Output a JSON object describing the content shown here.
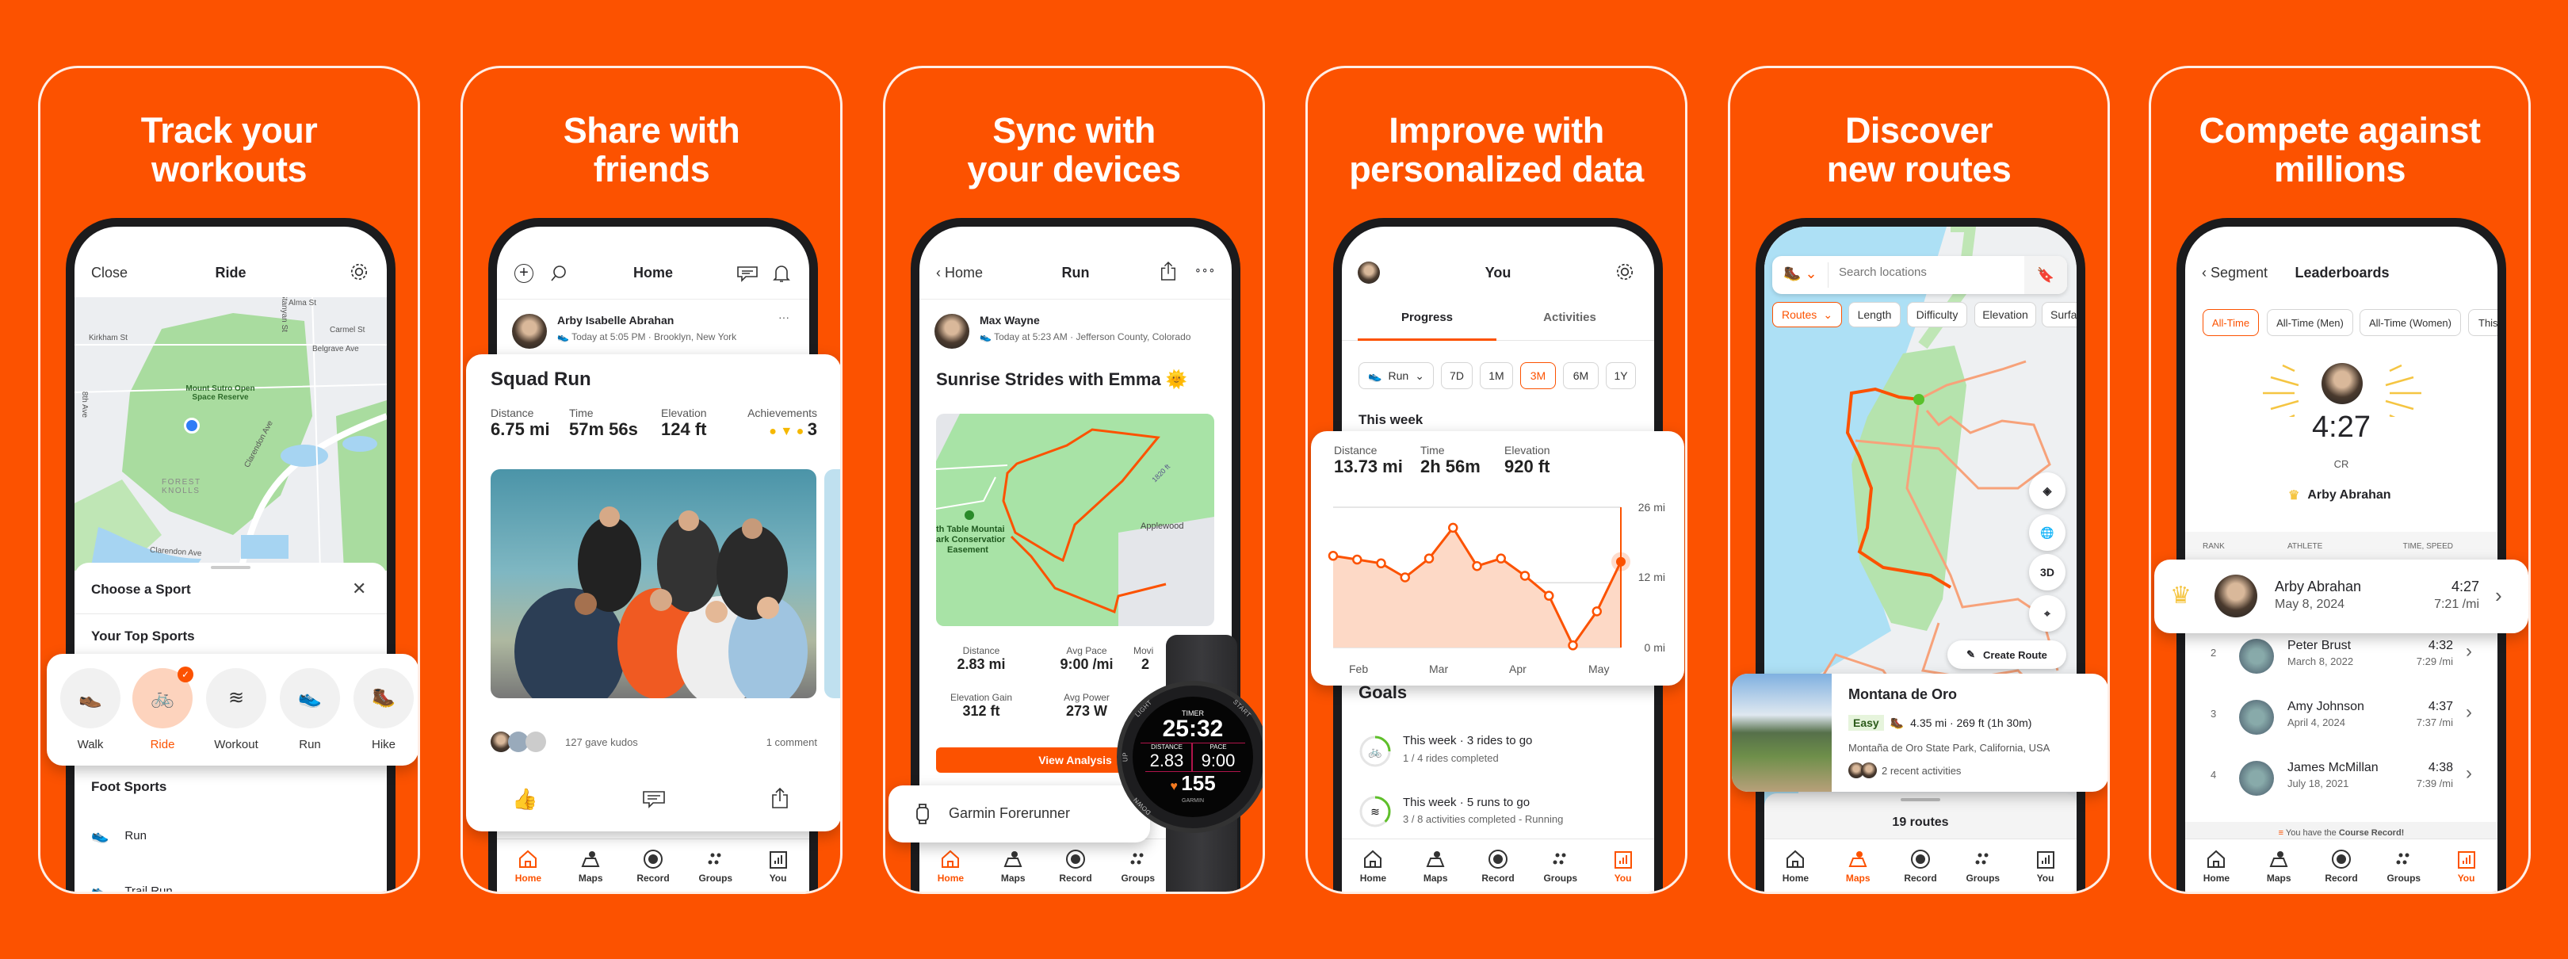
{
  "colors": {
    "brand": "#FC5200",
    "background": "#FC5200",
    "chart_fill": "#FDD9C6",
    "easy_badge": "#E6F4DC",
    "goal_ring": "#5FBF2A"
  },
  "nav": {
    "items": [
      {
        "label": "Home",
        "icon": "home-icon"
      },
      {
        "label": "Maps",
        "icon": "maps-icon"
      },
      {
        "label": "Record",
        "icon": "record-icon"
      },
      {
        "label": "Groups",
        "icon": "groups-icon"
      },
      {
        "label": "You",
        "icon": "you-icon"
      }
    ]
  },
  "panels": [
    {
      "title_line1": "Track your",
      "title_line2": "workouts",
      "header": {
        "left": "Close",
        "title": "Ride",
        "right_icon": "gear-icon"
      },
      "map": {
        "labels": [
          "Kirkham St",
          "Carmel St",
          "Belgrave Ave",
          "Mount Sutro Open",
          "Space Reserve",
          "FOREST",
          "KNOLLS",
          "Clarendon Ave",
          "Stanyan St",
          "Alma St",
          "8th Ave",
          "Clarendon Ave"
        ]
      },
      "sheet": {
        "title": "Choose a Sport",
        "top_heading": "Your Top Sports",
        "foot_heading": "Foot Sports",
        "top_sports": [
          {
            "label": "Walk",
            "icon": "walk-shoe-icon",
            "selected": false
          },
          {
            "label": "Ride",
            "icon": "bike-icon",
            "selected": true
          },
          {
            "label": "Workout",
            "icon": "workout-icon",
            "selected": false
          },
          {
            "label": "Run",
            "icon": "run-shoe-icon",
            "selected": false
          },
          {
            "label": "Hike",
            "icon": "hike-boot-icon",
            "selected": false
          }
        ],
        "foot_sports": [
          {
            "label": "Run",
            "icon": "run-shoe-icon"
          },
          {
            "label": "Trail Run",
            "icon": "trail-run-icon"
          }
        ]
      }
    },
    {
      "title_line1": "Share with",
      "title_line2": "friends",
      "header": {
        "title": "Home"
      },
      "post": {
        "athlete": "Arby Isabelle Abrahan",
        "meta": "Today at 5:05 PM · Brooklyn, New York",
        "title": "Squad Run",
        "stats": [
          {
            "label": "Distance",
            "value": "6.75 mi"
          },
          {
            "label": "Time",
            "value": "57m 56s"
          },
          {
            "label": "Elevation",
            "value": "124 ft"
          }
        ],
        "achievements": {
          "label": "Achievements",
          "count": "3"
        },
        "kudos": "127 gave kudos",
        "comments": "1 comment"
      },
      "active_nav": 0
    },
    {
      "title_line1": "Sync with",
      "title_line2": "your devices",
      "header": {
        "back": "Home",
        "title": "Run"
      },
      "post": {
        "athlete": "Max Wayne",
        "meta": "Today at 5:23 AM · Jefferson County, Colorado",
        "title": "Sunrise Strides with Emma 🌞",
        "map_labels": [
          "th Table Mountai",
          "ark Conservatior",
          "Easement",
          "Applewood",
          "1820 ft"
        ],
        "stats": [
          {
            "label": "Distance",
            "value": "2.83 mi"
          },
          {
            "label": "Avg Pace",
            "value": "9:00 /mi"
          },
          {
            "label": "Movi",
            "value": "2"
          },
          {
            "label": "Elevation Gain",
            "value": "312 ft"
          },
          {
            "label": "Avg Power",
            "value": "273 W"
          }
        ],
        "button": "View Analysis"
      },
      "device": {
        "name": "Garmin Forerunner"
      },
      "watch": {
        "timer_label": "TIMER",
        "timer": "25:32",
        "distance_label": "DISTANCE",
        "distance": "2.83",
        "pace_label": "PACE",
        "pace": "9:00",
        "heart_rate": "155",
        "brand": "GARMIN",
        "buttons": [
          "LIGHT",
          "UP",
          "DOWN",
          "START"
        ]
      },
      "active_nav": 0
    },
    {
      "title_line1": "Improve with",
      "title_line2": "personalized data",
      "header": {
        "title": "You"
      },
      "tabs": [
        {
          "label": "Progress",
          "active": true
        },
        {
          "label": "Activities",
          "active": false
        }
      ],
      "filters": {
        "sport": "Run",
        "ranges": [
          "7D",
          "1M",
          "3M",
          "6M",
          "1Y"
        ],
        "active_range": "3M"
      },
      "section": "This week",
      "stats": [
        {
          "label": "Distance",
          "value": "13.73 mi"
        },
        {
          "label": "Time",
          "value": "2h 56m"
        },
        {
          "label": "Elevation",
          "value": "920 ft"
        }
      ],
      "goals": {
        "title": "Goals",
        "items": [
          {
            "title": "This week · 3 rides to go",
            "subtitle": "1 / 4 rides completed",
            "icon": "bike-icon",
            "progress": 0.25
          },
          {
            "title": "This week · 5 runs to go",
            "subtitle": "3 / 8 activities completed - Running",
            "icon": "workout-icon",
            "progress": 0.375
          }
        ]
      },
      "active_nav": 4
    },
    {
      "title_line1": "Discover",
      "title_line2": "new routes",
      "search": {
        "placeholder": "Search locations"
      },
      "chips": [
        {
          "label": "Routes",
          "active": true
        },
        {
          "label": "Length"
        },
        {
          "label": "Difficulty"
        },
        {
          "label": "Elevation"
        },
        {
          "label": "Surfa"
        }
      ],
      "map_buttons": {
        "three_d": "3D",
        "create": "Create Route"
      },
      "route": {
        "name": "Montana de Oro",
        "difficulty": "Easy",
        "summary": "4.35 mi · 269 ft (1h 30m)",
        "location": "Montaña de Oro State Park, California, USA",
        "recent": "2 recent activities"
      },
      "count": "19 routes",
      "active_nav": 1
    },
    {
      "title_line1": "Compete against",
      "title_line2": "millions",
      "header": {
        "back": "Segment",
        "title": "Leaderboards"
      },
      "chips": [
        {
          "label": "All-Time",
          "active": true
        },
        {
          "label": "All-Time (Men)"
        },
        {
          "label": "All-Time (Women)"
        },
        {
          "label": "This Y"
        }
      ],
      "record": {
        "time": "4:27",
        "label": "CR",
        "holder": "Arby Abrahan"
      },
      "columns": [
        "RANK",
        "ATHLETE",
        "TIME, SPEED"
      ],
      "rows": [
        {
          "rank": "1",
          "name": "Arby Abrahan",
          "date": "May 8, 2024",
          "time": "4:27",
          "pace": "7:21 /mi"
        },
        {
          "rank": "2",
          "name": "Peter Brust",
          "date": "March 8, 2022",
          "time": "4:32",
          "pace": "7:29 /mi"
        },
        {
          "rank": "3",
          "name": "Amy Johnson",
          "date": "April 4, 2024",
          "time": "4:37",
          "pace": "7:37 /mi"
        },
        {
          "rank": "4",
          "name": "James McMillan",
          "date": "July 18, 2021",
          "time": "4:38",
          "pace": "7:39 /mi"
        }
      ],
      "banner": {
        "prefix": "You have the ",
        "strong": "Course Record!"
      },
      "active_nav": 4
    }
  ],
  "chart_data": {
    "type": "area",
    "title": "",
    "xlabel": "",
    "ylabel": "",
    "x_tick_labels": [
      "Feb",
      "Mar",
      "Apr",
      "May"
    ],
    "y_tick_labels": [
      "26 mi",
      "12 mi",
      "0 mi"
    ],
    "y_ticks": [
      26,
      12,
      0
    ],
    "ylim": [
      0,
      26
    ],
    "values": [
      17.0,
      16.3,
      15.6,
      13.0,
      16.5,
      22.2,
      15.1,
      16.5,
      13.3,
      9.6,
      0.4,
      6.7,
      15.9
    ],
    "highlight_index": 12,
    "grid": true,
    "unit": "mi"
  }
}
